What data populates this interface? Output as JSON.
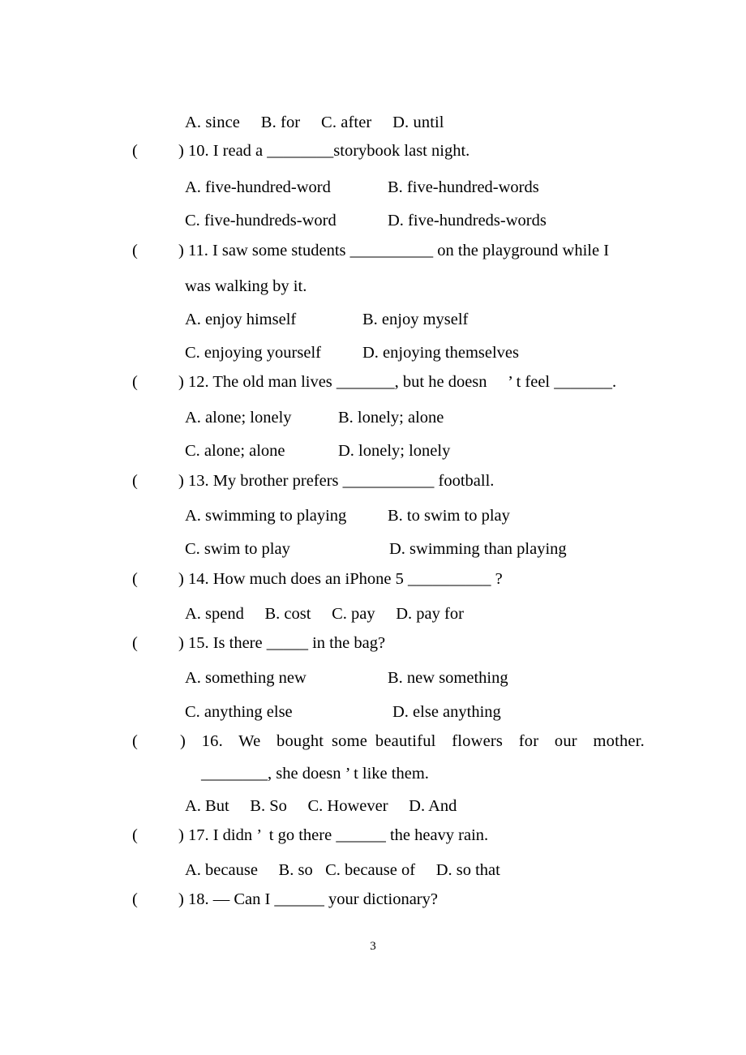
{
  "document": {
    "page_number": "3",
    "carryover_options_line": "A. since  B. for  C. after  D. until"
  },
  "questions": [
    {
      "number": "10",
      "bracket_open": "(",
      "bracket_close": ")",
      "stem": ") 10. I read a ________storybook last night.",
      "options": [
        {
          "label": "A. five-hundred-word",
          "column": 1
        },
        {
          "label": "B. five-hundred-words",
          "column": 2
        },
        {
          "label": "C. five-hundreds-word",
          "column": 1
        },
        {
          "label": "D. five-hundreds-words",
          "column": 2
        }
      ]
    },
    {
      "number": "11",
      "bracket_open": "(",
      "bracket_close": ")",
      "stem": ") 11. I saw some students __________ on the playground while I",
      "continuation": "was walking by it.",
      "options": [
        {
          "label": "A. enjoy himself",
          "column": 1
        },
        {
          "label": "B. enjoy myself",
          "column": 2
        },
        {
          "label": "C. enjoying yourself",
          "column": 1
        },
        {
          "label": "D. enjoying themselves",
          "column": 2
        }
      ]
    },
    {
      "number": "12",
      "bracket_open": "(",
      "bracket_close": ")",
      "stem": ") 12. The old man lives _______, but he doesn  ’ t feel _______.",
      "options": [
        {
          "label": "A. alone; lonely",
          "column": 1
        },
        {
          "label": "B. lonely; alone",
          "column": 2
        },
        {
          "label": "C. alone; alone",
          "column": 1
        },
        {
          "label": "D. lonely; lonely",
          "column": 2
        }
      ]
    },
    {
      "number": "13",
      "bracket_open": "(",
      "bracket_close": ")",
      "stem": ") 13. My brother prefers ___________ football.",
      "options": [
        {
          "label": "A. swimming to playing",
          "column": 1
        },
        {
          "label": "B. to swim to play",
          "column": 2
        },
        {
          "label": "C. swim to play",
          "column": 1
        },
        {
          "label": "D. swimming than playing",
          "column": 2
        }
      ]
    },
    {
      "number": "14",
      "bracket_open": "(",
      "bracket_close": ")",
      "stem": ") 14. How much does an iPhone 5 __________ ?",
      "options": [
        {
          "label": "A. spend  B. cost  C. pay  D. pay for",
          "column": 1
        }
      ]
    },
    {
      "number": "15",
      "bracket_open": "(",
      "bracket_close": ")",
      "stem": ") 15. Is there _____ in the bag?",
      "options": [
        {
          "label": "A. something new",
          "column": 1
        },
        {
          "label": "B. new something",
          "column": 2
        },
        {
          "label": "C. anything else",
          "column": 1
        },
        {
          "label": "D. else anything",
          "column": 2
        }
      ]
    },
    {
      "number": "16",
      "bracket_open": "(",
      "bracket_close": ")",
      "stem": ")  16.  We  bought some beautiful  flowers  for  our  mother.",
      "continuation": "________, she doesn ’ t like them.",
      "options": [
        {
          "label": "A. But  B. So  C. However  D. And",
          "column": 1
        }
      ]
    },
    {
      "number": "17",
      "bracket_open": "(",
      "bracket_close": ")",
      "stem": ") 17. I didn ’  t go there ______ the heavy rain.",
      "options": [
        {
          "label": "A. because  B. so  C. because of  D. so that",
          "column": 1
        }
      ]
    },
    {
      "number": "18",
      "bracket_open": "(",
      "bracket_close": ")",
      "stem": ") 18. — Can I ______ your dictionary?",
      "options": []
    }
  ]
}
